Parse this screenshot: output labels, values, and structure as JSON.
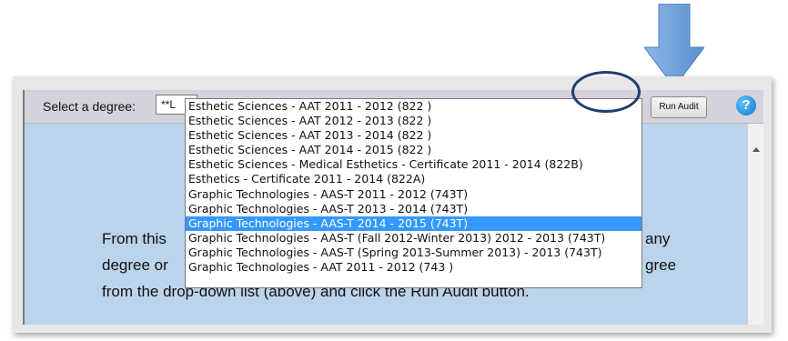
{
  "toolbar": {
    "select_label": "Select a degree:",
    "select_value": "**L",
    "run_audit_label": "Run Audit",
    "help_icon": "?"
  },
  "dropdown": {
    "options": [
      "Esthetic Sciences - AAT 2011 - 2012 (822 )",
      "Esthetic Sciences - AAT 2012 - 2013 (822 )",
      "Esthetic Sciences - AAT 2013 - 2014 (822 )",
      "Esthetic Sciences - AAT 2014 - 2015 (822 )",
      "Esthetic Sciences - Medical Esthetics - Certificate 2011 - 2014 (822B)",
      "Esthetics - Certificate 2011 - 2014 (822A)",
      "Graphic Technologies - AAS-T 2011 - 2012 (743T)",
      "Graphic Technologies - AAS-T 2013 - 2014 (743T)",
      "Graphic Technologies - AAS-T 2014 - 2015 (743T)",
      "Graphic Technologies - AAS-T (Fall 2012-Winter 2013) 2012 - 2013 (743T)",
      "Graphic Technologies - AAS-T (Spring 2013-Summer 2013) - 2013 (743T)",
      "Graphic Technologies - AAT 2011 - 2012 (743 )"
    ],
    "selected_index": 8
  },
  "content": {
    "line1": "From this",
    "line1_end": "any",
    "line2": "degree or",
    "line2_end": "gree",
    "line3": "from the drop-down list (above) and click the Run Audit button."
  },
  "colors": {
    "toolbar_bg": "#d3d3dc",
    "content_bg": "#bcd3ec",
    "selection": "#3399ff",
    "annotation_arrow": "#6fa0d8",
    "annotation_circle": "#1f3f6e"
  }
}
